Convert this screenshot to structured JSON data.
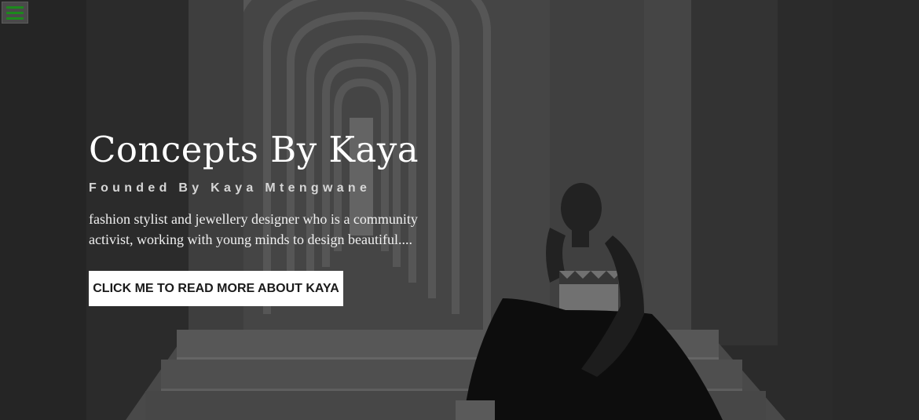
{
  "menu": {
    "icon": "hamburger-icon",
    "accent_color": "#1c8a1c"
  },
  "hero": {
    "title": "Concepts By Kaya",
    "subtitle": "Founded By Kaya Mtengwane",
    "description": "fashion stylist and jewellery designer who is a community activist, working with young minds to design beautiful....",
    "cta_label": "CLICK ME TO READ MORE ABOUT KAYA",
    "background_image": "woman-seated-on-steps-in-arched-corridor-photo"
  }
}
